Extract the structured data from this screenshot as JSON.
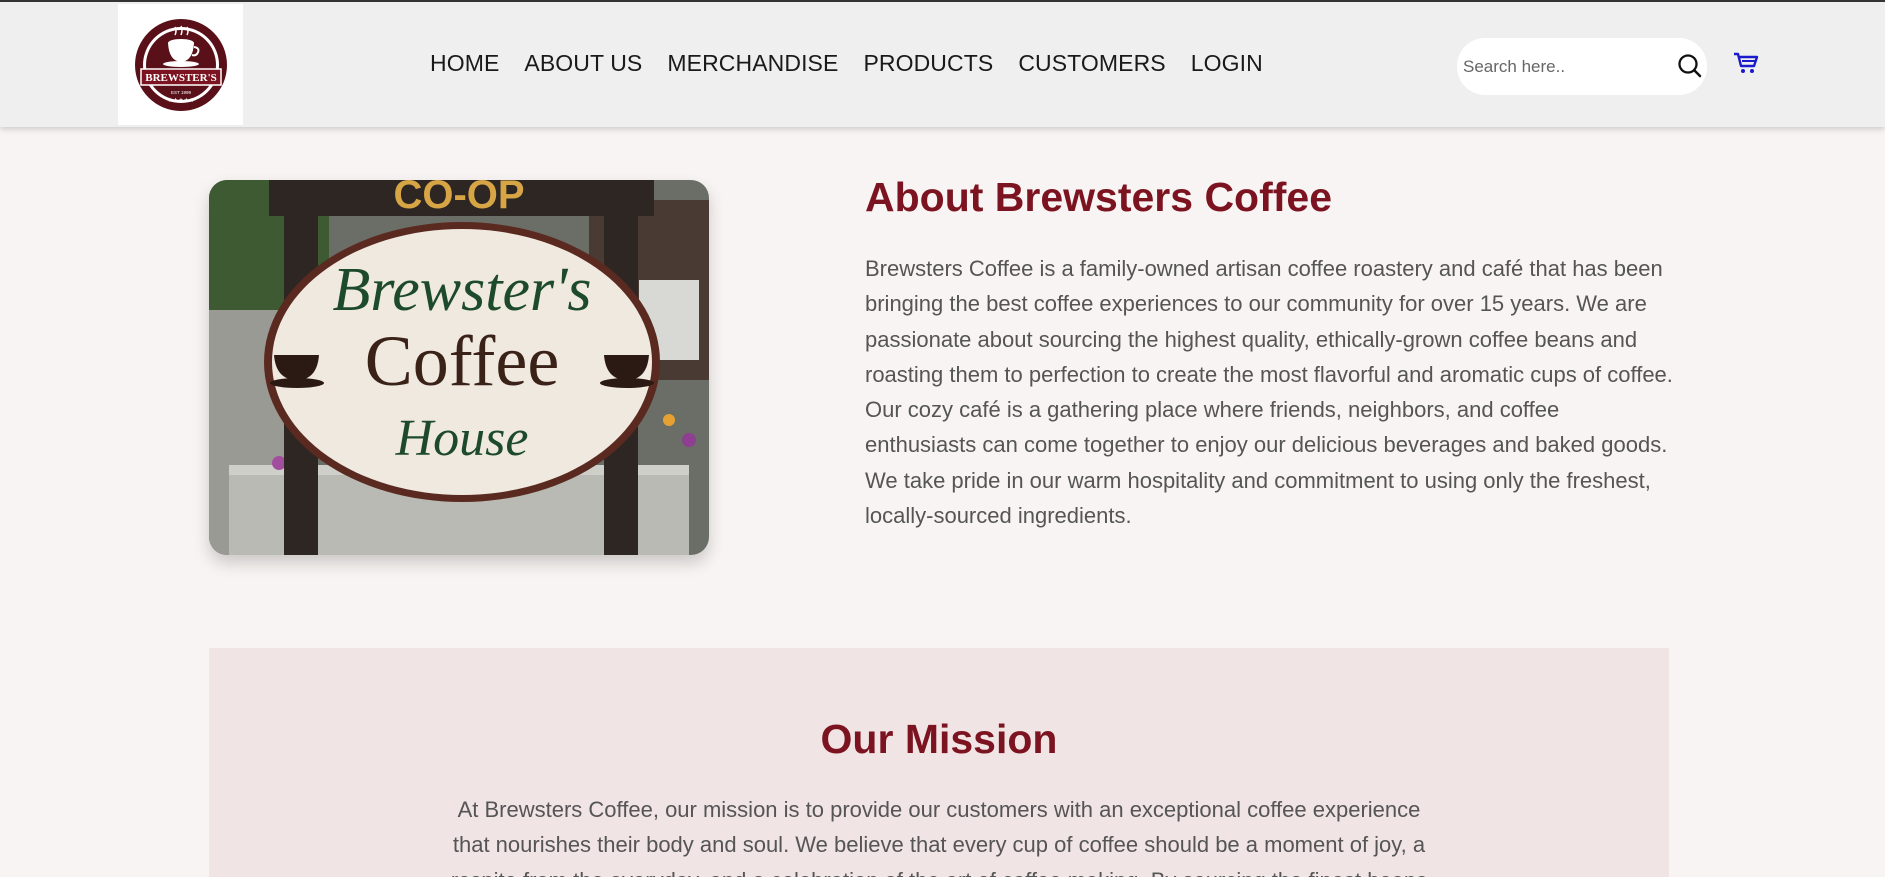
{
  "brand": {
    "logo_top_text": "WELCOME TO HOME OF TASTE CAFE",
    "logo_banner": "BREWSTER'S",
    "logo_est": "EST 1999"
  },
  "nav": {
    "items": [
      "HOME",
      "ABOUT US",
      "MERCHANDISE",
      "PRODUCTS",
      "CUSTOMERS",
      "LOGIN"
    ]
  },
  "search": {
    "placeholder": "Search here.."
  },
  "icons": {
    "search": "search-icon",
    "cart": "cart-icon"
  },
  "colors": {
    "accent": "#7b1420",
    "cart": "#1a1acc",
    "header_bg": "#efefef",
    "page_bg": "#f8f4f3",
    "mission_bg": "#f1e4e4"
  },
  "about": {
    "title": "About Brewsters Coffee",
    "sign_line1": "Brewster's",
    "sign_line2": "Coffee",
    "sign_line3": "House",
    "sign_top": "CO-OP",
    "paragraph1": "Brewsters Coffee is a family-owned artisan coffee roastery and café that has been bringing the best coffee experiences to our community for over 15 years. We are passionate about sourcing the highest quality, ethically-grown coffee beans and roasting them to perfection to create the most flavorful and aromatic cups of coffee.",
    "paragraph2": "Our cozy café is a gathering place where friends, neighbors, and coffee enthusiasts can come together to enjoy our delicious beverages and baked goods. We take pride in our warm hospitality and commitment to using only the freshest, locally-sourced ingredients."
  },
  "mission": {
    "title": "Our Mission",
    "paragraph": "At Brewsters Coffee, our mission is to provide our customers with an exceptional coffee experience that nourishes their body and soul. We believe that every cup of coffee should be a moment of joy, a respite from the everyday, and a celebration of the art of coffee making. By sourcing the finest beans"
  }
}
